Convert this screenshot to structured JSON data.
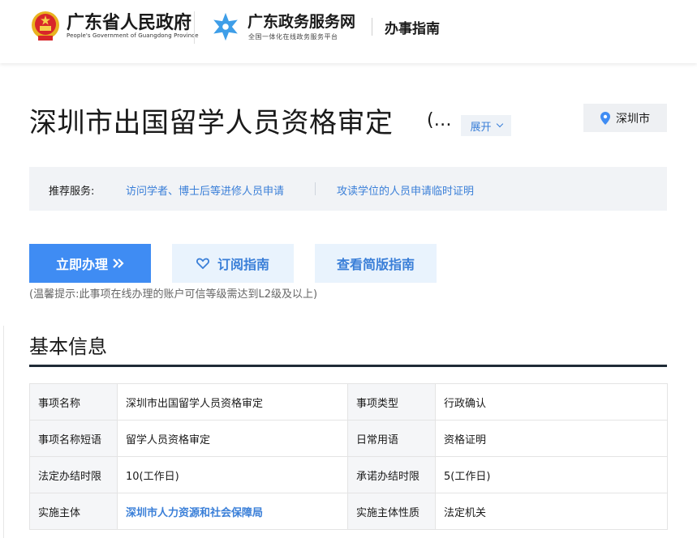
{
  "header": {
    "gov_title": "广东省人民政府",
    "gov_subtitle": "People's Government of Guangdong Province",
    "service_title": "广东政务服务网",
    "service_subtitle": "全国一体化在线政务服务平台",
    "guide_label": "办事指南"
  },
  "title": {
    "text": "深圳市出国留学人员资格审定",
    "more": "(…",
    "expand_label": "展开",
    "location": "深圳市"
  },
  "recommend": {
    "label": "推荐服务:",
    "links": [
      "访问学者、博士后等进修人员申请",
      "攻读学位的人员申请临时证明"
    ]
  },
  "actions": {
    "apply_label": "立即办理",
    "subscribe_label": "订阅指南",
    "simple_label": "查看简版指南",
    "tip": "(温馨提示:此事项在线办理的账户可信等级需达到L2级及以上)"
  },
  "basic_info": {
    "title": "基本信息",
    "rows": [
      [
        "事项名称",
        "深圳市出国留学人员资格审定",
        "事项类型",
        "行政确认"
      ],
      [
        "事项名称短语",
        "留学人员资格审定",
        "日常用语",
        "资格证明"
      ],
      [
        "法定办结时限",
        "10(工作日)",
        "承诺办结时限",
        "5(工作日)"
      ],
      [
        "实施主体",
        "深圳市人力资源和社会保障局",
        "实施主体性质",
        "法定机关"
      ]
    ]
  },
  "colors": {
    "accent": "#3f8cf3",
    "link": "#3a7fd8",
    "light_button": "#e9f3fd",
    "emblem_red": "#d8262a",
    "emblem_gold": "#e8b21f"
  }
}
